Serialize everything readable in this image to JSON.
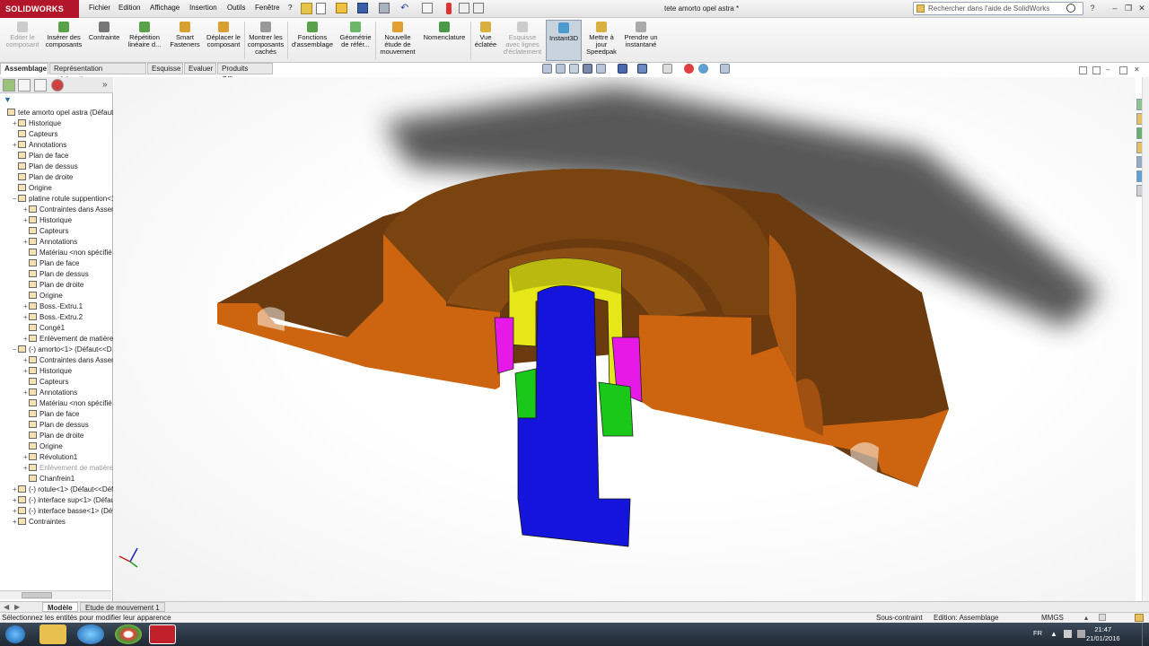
{
  "window": {
    "app_name": "SOLIDWORKS",
    "document_title": "tete amorto opel astra *",
    "search_placeholder": "Rechercher dans l'aide de SolidWorks",
    "menu": [
      "Fichier",
      "Edition",
      "Affichage",
      "Insertion",
      "Outils",
      "Fenêtre",
      "?"
    ]
  },
  "ribbon": {
    "buttons": [
      {
        "label": "Editer le composant",
        "disabled": true
      },
      {
        "label": "Insérer des composants",
        "disabled": false
      },
      {
        "label": "Contrainte",
        "disabled": false
      },
      {
        "label": "Répétition linéaire d...",
        "disabled": false
      },
      {
        "label": "Smart Fasteners",
        "disabled": false
      },
      {
        "label": "Déplacer le composant",
        "disabled": false
      },
      {
        "label": "Montrer les composants cachés",
        "disabled": false
      },
      {
        "label": "Fonctions d'assemblage",
        "disabled": false
      },
      {
        "label": "Géométrie de référ...",
        "disabled": false
      },
      {
        "label": "Nouvelle étude de mouvement",
        "disabled": false
      },
      {
        "label": "Nomenclature",
        "disabled": false
      },
      {
        "label": "Vue éclatée",
        "disabled": false
      },
      {
        "label": "Esquisse avec lignes d'éclatement",
        "disabled": true
      },
      {
        "label": "Instant3D",
        "disabled": false,
        "active": true
      },
      {
        "label": "Mettre à jour Speedpak",
        "disabled": false
      },
      {
        "label": "Prendre un instantané",
        "disabled": false
      }
    ]
  },
  "command_tabs": [
    "Assemblage",
    "Représentation schématique",
    "Esquisse",
    "Evaluer",
    "Produits Office"
  ],
  "tree": {
    "root": "tete amorto opel astra  (Défaut-",
    "items": [
      {
        "label": "Historique",
        "indent": 1,
        "exp": "+"
      },
      {
        "label": "Capteurs",
        "indent": 1,
        "exp": ""
      },
      {
        "label": "Annotations",
        "indent": 1,
        "exp": "+"
      },
      {
        "label": "Plan de face",
        "indent": 1,
        "exp": ""
      },
      {
        "label": "Plan de dessus",
        "indent": 1,
        "exp": ""
      },
      {
        "label": "Plan de droite",
        "indent": 1,
        "exp": ""
      },
      {
        "label": "Origine",
        "indent": 1,
        "exp": ""
      },
      {
        "label": "platine rotule suppention<1",
        "indent": 1,
        "exp": "−"
      },
      {
        "label": "Contraintes dans Assem",
        "indent": 2,
        "exp": "+"
      },
      {
        "label": "Historique",
        "indent": 2,
        "exp": "+"
      },
      {
        "label": "Capteurs",
        "indent": 2,
        "exp": ""
      },
      {
        "label": "Annotations",
        "indent": 2,
        "exp": "+"
      },
      {
        "label": "Matériau <non spécifié",
        "indent": 2,
        "exp": ""
      },
      {
        "label": "Plan de face",
        "indent": 2,
        "exp": ""
      },
      {
        "label": "Plan de dessus",
        "indent": 2,
        "exp": ""
      },
      {
        "label": "Plan de droite",
        "indent": 2,
        "exp": ""
      },
      {
        "label": "Origine",
        "indent": 2,
        "exp": ""
      },
      {
        "label": "Boss.-Extru.1",
        "indent": 2,
        "exp": "+"
      },
      {
        "label": "Boss.-Extru.2",
        "indent": 2,
        "exp": "+"
      },
      {
        "label": "Congé1",
        "indent": 2,
        "exp": ""
      },
      {
        "label": "Enlèvement de matière-",
        "indent": 2,
        "exp": "+"
      },
      {
        "label": "(-) amorto<1> (Défaut<<D",
        "indent": 1,
        "exp": "−"
      },
      {
        "label": "Contraintes dans Assem",
        "indent": 2,
        "exp": "+"
      },
      {
        "label": "Historique",
        "indent": 2,
        "exp": "+"
      },
      {
        "label": "Capteurs",
        "indent": 2,
        "exp": ""
      },
      {
        "label": "Annotations",
        "indent": 2,
        "exp": "+"
      },
      {
        "label": "Matériau <non spécifié",
        "indent": 2,
        "exp": ""
      },
      {
        "label": "Plan de face",
        "indent": 2,
        "exp": ""
      },
      {
        "label": "Plan de dessus",
        "indent": 2,
        "exp": ""
      },
      {
        "label": "Plan de droite",
        "indent": 2,
        "exp": ""
      },
      {
        "label": "Origine",
        "indent": 2,
        "exp": ""
      },
      {
        "label": "Révolution1",
        "indent": 2,
        "exp": "+"
      },
      {
        "label": "Enlèvement de matière-",
        "indent": 2,
        "exp": "+",
        "grey": true
      },
      {
        "label": "Chanfrein1",
        "indent": 2,
        "exp": ""
      },
      {
        "label": "(-) rotule<1> (Défaut<<Déf",
        "indent": 1,
        "exp": "+"
      },
      {
        "label": "(-) interface sup<1> (Défau",
        "indent": 1,
        "exp": "+"
      },
      {
        "label": "(-) interface basse<1> (Défa",
        "indent": 1,
        "exp": "+"
      },
      {
        "label": "Contraintes",
        "indent": 1,
        "exp": "+"
      }
    ]
  },
  "bottom_tabs": [
    "Modèle",
    "Etude de mouvement 1"
  ],
  "status": {
    "message": "Sélectionnez les entités pour modifier leur apparence",
    "constraint": "Sous-contraint",
    "mode": "Edition: Assemblage",
    "units": "MMGS"
  },
  "taskbar": {
    "lang": "FR",
    "time": "21:47",
    "date": "21/01/2016"
  },
  "colors": {
    "brand": "#b3162a",
    "brown_part": "#c8600e",
    "yellow_part": "#e6e619",
    "magenta_part": "#e619e6",
    "green_part": "#19c819",
    "blue_part": "#1414dc"
  }
}
